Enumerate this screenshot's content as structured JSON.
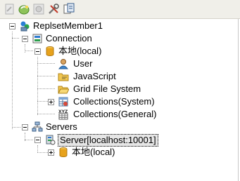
{
  "toolbar": {
    "buttons": [
      {
        "icon": "new-document-icon",
        "enabled": false
      },
      {
        "icon": "refresh-icon",
        "enabled": true
      },
      {
        "icon": "record-icon",
        "enabled": false
      },
      {
        "icon": "tools-icon",
        "enabled": true
      },
      {
        "icon": "copy-icon",
        "enabled": true
      }
    ]
  },
  "tree": {
    "root": "ReplsetMember1",
    "connection": "Connection",
    "local_db": "本地(local)",
    "user": "User",
    "javascript": "JavaScript",
    "gridfs": "Grid File System",
    "collections_system": "Collections(System)",
    "collections_general": "Collections(General)",
    "servers": "Servers",
    "server": "Server[localhost:10001]",
    "server_local_db": "本地(local)"
  },
  "colors": {
    "toolbar_bg": "#f0efe9",
    "selection_bg": "#e6e6e6",
    "db_icon": "#e7a21c",
    "folder_icon": "#f1c64f"
  }
}
